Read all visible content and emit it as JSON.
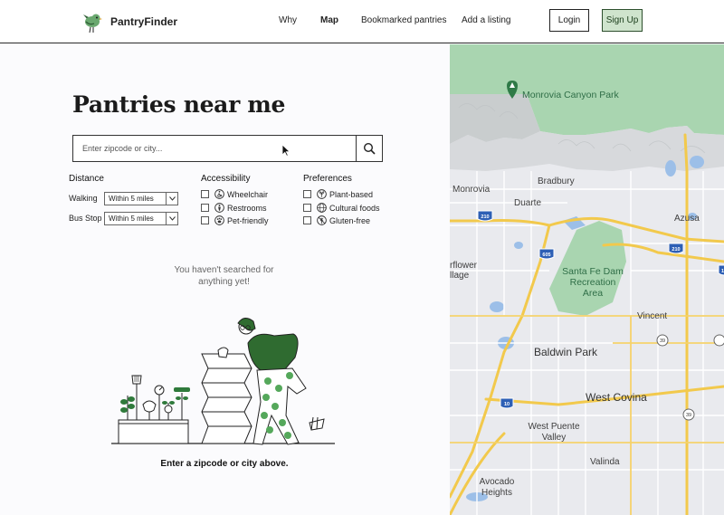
{
  "brand": {
    "name": "PantryFinder",
    "logo_icon": "bird-icon",
    "accent": "#3f7f4a"
  },
  "nav": {
    "items": [
      {
        "label": "Why",
        "active": false
      },
      {
        "label": "Map",
        "active": true
      },
      {
        "label": "Bookmarked pantries",
        "active": false
      },
      {
        "label": "Add a listing",
        "active": false
      }
    ],
    "login_label": "Login",
    "signup_label": "Sign Up"
  },
  "main": {
    "title": "Pantries near me",
    "search": {
      "placeholder": "Enter zipcode or city...",
      "value": "",
      "button_icon": "search-icon"
    },
    "filters": {
      "distance": {
        "heading": "Distance",
        "rows": [
          {
            "label": "Walking",
            "selected": "Within 5 miles"
          },
          {
            "label": "Bus Stop",
            "selected": "Within 5 miles"
          }
        ]
      },
      "accessibility": {
        "heading": "Accessibility",
        "options": [
          {
            "label": "Wheelchair",
            "icon": "wheelchair-icon",
            "checked": false
          },
          {
            "label": "Restrooms",
            "icon": "restroom-icon",
            "checked": false
          },
          {
            "label": "Pet-friendly",
            "icon": "paw-icon",
            "checked": false
          }
        ]
      },
      "preferences": {
        "heading": "Preferences",
        "options": [
          {
            "label": "Plant-based",
            "icon": "leaf-icon",
            "checked": false
          },
          {
            "label": "Cultural foods",
            "icon": "globe-icon",
            "checked": false
          },
          {
            "label": "Gluten-free",
            "icon": "no-gluten-icon",
            "checked": false
          }
        ]
      }
    },
    "empty_state": {
      "line1": "You haven't searched for",
      "line2": "anything yet!",
      "cta": "Enter a zipcode or city above."
    }
  },
  "map": {
    "labels": {
      "park": "Monrovia Canyon Park",
      "bradbury": "Bradbury",
      "monrovia": "Monrovia",
      "duarte": "Duarte",
      "azusa": "Azusa",
      "santa_fe_1": "Santa Fe Dam",
      "santa_fe_2": "Recreation",
      "santa_fe_3": "Area",
      "irwindale_1": "rflower",
      "irwindale_2": "llage",
      "vincent": "Vincent",
      "baldwin": "Baldwin Park",
      "west_covina": "West Covina",
      "wp1": "West Puente",
      "wp2": "Valley",
      "valinda": "Valinda",
      "avocado1": "Avocado",
      "avocado2": "Heights"
    },
    "shields": {
      "i210a": "210",
      "i210b": "210",
      "i605": "605",
      "i10": "10",
      "r39a": "39",
      "r39b": "39",
      "i10b": "10"
    },
    "colors": {
      "park": "#a7d3ae",
      "highway": "#f2c94c",
      "water": "#9cbfe8",
      "land": "#e9eaee"
    }
  }
}
